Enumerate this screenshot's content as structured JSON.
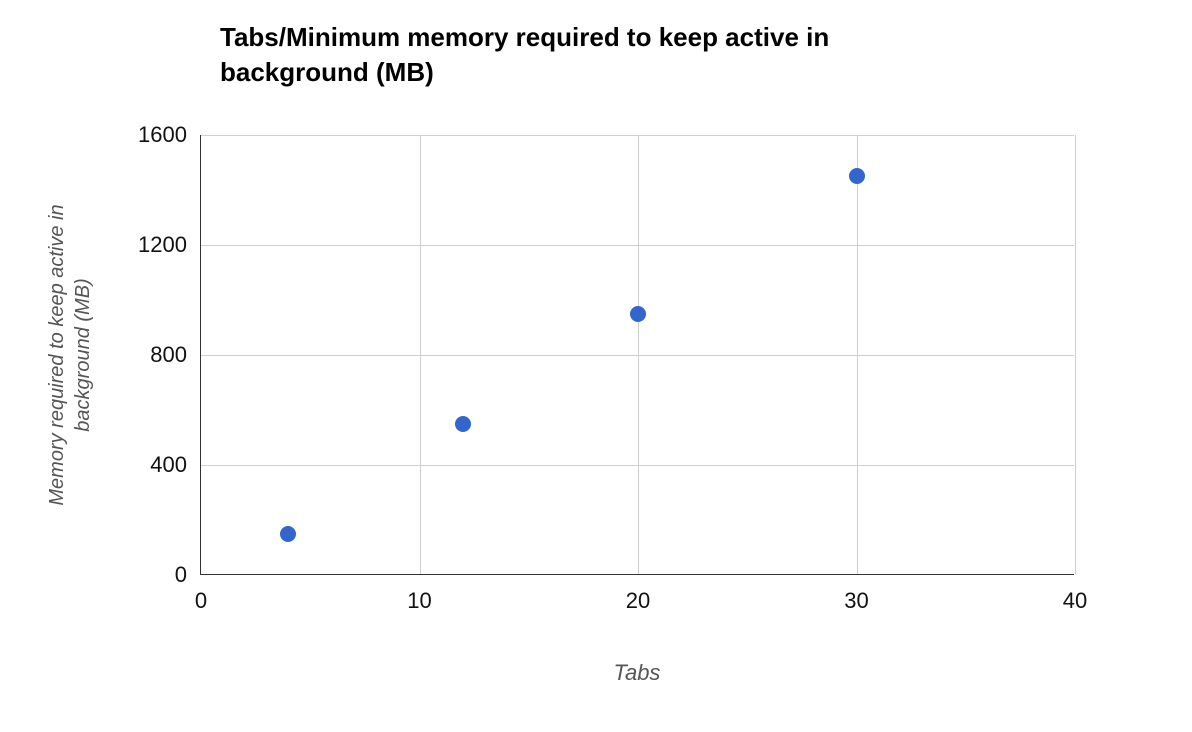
{
  "chart_data": {
    "type": "scatter",
    "title": "Tabs/Minimum memory required to keep active in background (MB)",
    "xlabel": "Tabs",
    "ylabel": "Memory required to keep active in\nbackground (MB)",
    "xlim": [
      0,
      40
    ],
    "ylim": [
      0,
      1600
    ],
    "xticks": [
      0,
      10,
      20,
      30,
      40
    ],
    "yticks": [
      0,
      400,
      800,
      1200,
      1600
    ],
    "grid": true,
    "legend": false,
    "point_color": "#3366cc",
    "series": [
      {
        "name": "Memory required to keep active in background (MB)",
        "x": [
          4,
          12,
          20,
          30
        ],
        "y": [
          150,
          550,
          950,
          1450
        ]
      }
    ]
  }
}
